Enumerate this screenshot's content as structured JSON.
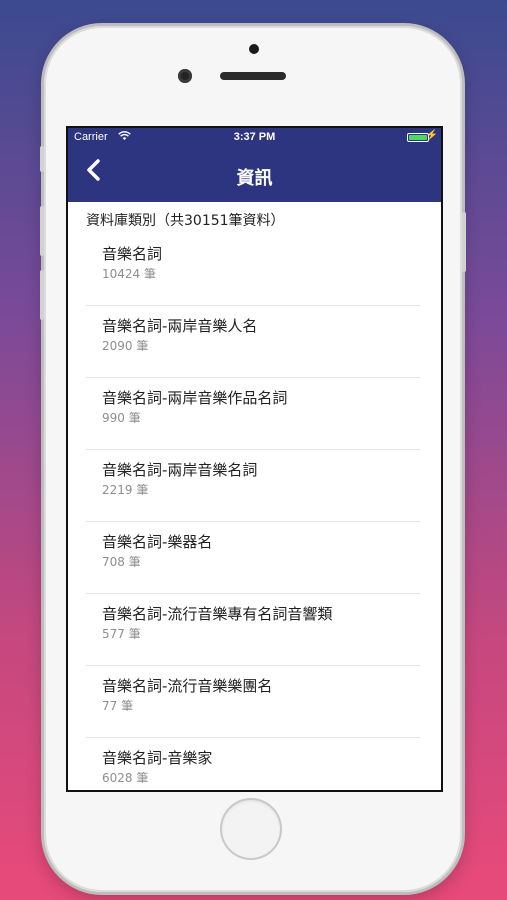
{
  "status_bar": {
    "carrier": "Carrier",
    "time": "3:37 PM"
  },
  "nav": {
    "back_icon": "<",
    "title": "資訊"
  },
  "section": {
    "header": "資料庫類別（共30151筆資料）"
  },
  "items": [
    {
      "name": "音樂名詞",
      "count": "10424 筆"
    },
    {
      "name": "音樂名詞-兩岸音樂人名",
      "count": "2090 筆"
    },
    {
      "name": "音樂名詞-兩岸音樂作品名詞",
      "count": "990 筆"
    },
    {
      "name": "音樂名詞-兩岸音樂名詞",
      "count": "2219 筆"
    },
    {
      "name": "音樂名詞-樂器名",
      "count": "708 筆"
    },
    {
      "name": "音樂名詞-流行音樂專有名詞音響類",
      "count": "577 筆"
    },
    {
      "name": "音樂名詞-流行音樂樂團名",
      "count": "77 筆"
    },
    {
      "name": "音樂名詞-音樂家",
      "count": "6028 筆"
    }
  ],
  "colors": {
    "nav_bg": "#2d3580",
    "battery": "#4cd964"
  },
  "icons": [
    "wifi-icon",
    "battery-icon",
    "back-chevron-icon"
  ]
}
